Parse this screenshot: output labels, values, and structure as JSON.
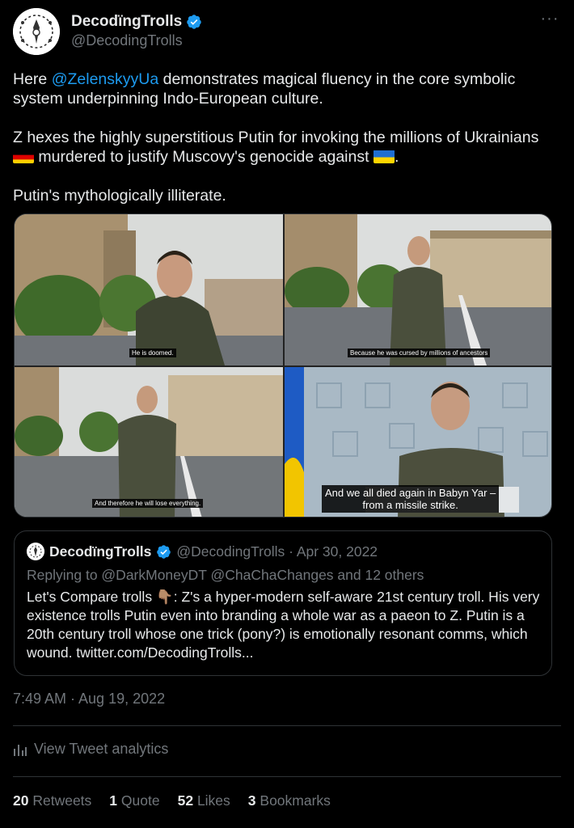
{
  "author": {
    "display_name": "DecodïngTrolls",
    "handle": "@DecodingTrolls"
  },
  "more_label": "···",
  "tweet": {
    "line1_pre": "Here ",
    "line1_mention": "@ZelenskyyUa",
    "line1_post": " demonstrates magical fluency in the core symbolic system underpinning Indo-European culture.",
    "line2_a": "Z hexes the highly superstitious Putin for invoking the millions of Ukrainians ",
    "line2_b": " murdered to justify Muscovy's genocide against ",
    "line2_c": ".",
    "line3": "Putin's mythologically illiterate."
  },
  "media": {
    "subtitles": [
      "He is doomed.",
      "Because he was cursed by millions of ancestors",
      "And therefore he will lose everything.",
      "And we all died again in Babyn Yar –\nfrom a missile strike."
    ]
  },
  "quote": {
    "display_name": "DecodïngTrolls",
    "meta": "@DecodingTrolls · Apr 30, 2022",
    "reply_line": "Replying to @DarkMoneyDT @ChaChaChanges and 12 others",
    "body": "Let's Compare trolls 👇🏽: Z's a hyper-modern self-aware 21st century troll. His very existence trolls Putin even into branding a whole war as a paeon to Z. Putin is a 20th century troll whose one trick (pony?) is emotionally resonant comms, which wound. twitter.com/DecodingTrolls..."
  },
  "timestamp": "7:49 AM · Aug 19, 2022",
  "analytics_label": "View Tweet analytics",
  "stats": {
    "retweets_num": "20",
    "retweets_label": "Retweets",
    "quotes_num": "1",
    "quotes_label": "Quote",
    "likes_num": "52",
    "likes_label": "Likes",
    "bookmarks_num": "3",
    "bookmarks_label": "Bookmarks"
  },
  "colors": {
    "accent": "#1d9bf0",
    "muted": "#71767b",
    "text": "#e7e9ea",
    "bg": "#000000"
  }
}
